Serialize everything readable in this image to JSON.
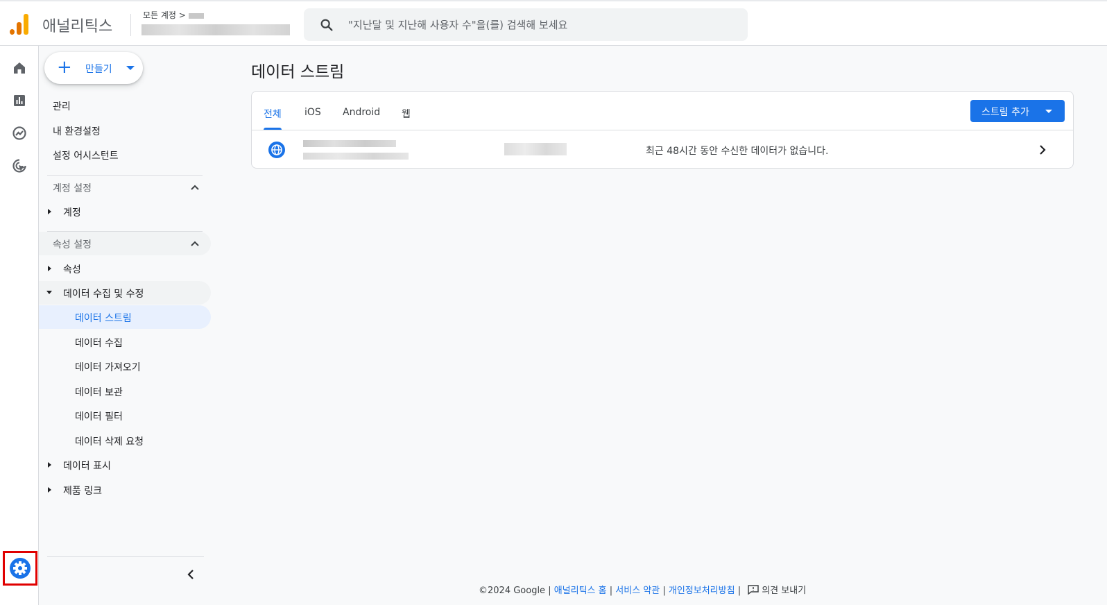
{
  "header": {
    "app_name": "애널리틱스",
    "breadcrumb": "모든 계정 >",
    "search_placeholder": "\"지난달 및 지난해 사용자 수\"을(를) 검색해 보세요"
  },
  "rail": {
    "icons": [
      "home-icon",
      "reports-icon",
      "explore-icon",
      "advertising-icon"
    ],
    "admin_icon": "gear-icon"
  },
  "sidebar": {
    "create_label": "만들기",
    "top_items": [
      "관리",
      "내 환경설정",
      "설정 어시스턴트"
    ],
    "account_section": {
      "title": "계정 설정",
      "items": [
        "계정"
      ]
    },
    "property_section": {
      "title": "속성 설정",
      "items": [
        "속성",
        "데이터 수집 및 수정"
      ],
      "sub_items": [
        "데이터 스트림",
        "데이터 수집",
        "데이터 가져오기",
        "데이터 보관",
        "데이터 필터",
        "데이터 삭제 요청"
      ],
      "more_items": [
        "데이터 표시",
        "제품 링크"
      ]
    }
  },
  "main": {
    "title": "데이터 스트림",
    "tabs": [
      "전체",
      "iOS",
      "Android",
      "웹"
    ],
    "active_tab": "전체",
    "add_stream_label": "스트림 추가",
    "stream_row": {
      "status": "최근 48시간 동안 수신한 데이터가 없습니다."
    }
  },
  "footer": {
    "copyright": "©2024 Google |",
    "links": [
      "애널리틱스 홈",
      "서비스 약관",
      "개인정보처리방침"
    ],
    "feedback": "의견 보내기"
  },
  "colors": {
    "accent": "#1a73e8",
    "highlight_border": "#e00000"
  }
}
